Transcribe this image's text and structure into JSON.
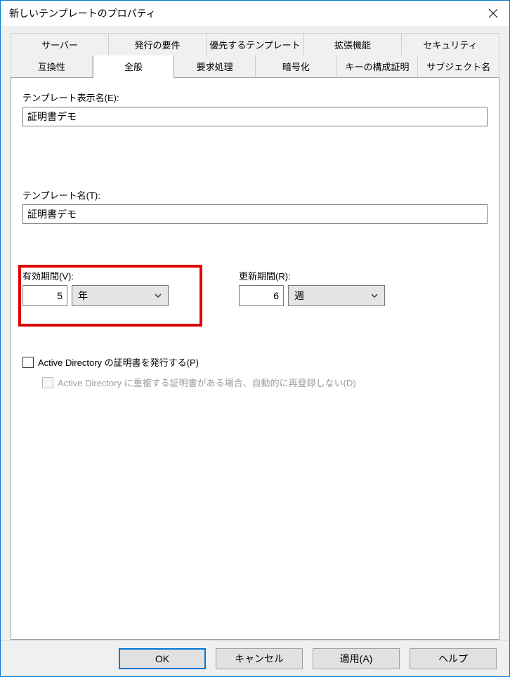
{
  "title": "新しいテンプレートのプロパティ",
  "tabs_row1": [
    "サーバー",
    "発行の要件",
    "優先するテンプレート",
    "拡張機能",
    "セキュリティ"
  ],
  "tabs_row2": [
    "互換性",
    "全般",
    "要求処理",
    "暗号化",
    "キーの構成証明",
    "サブジェクト名"
  ],
  "active_tab": "全般",
  "display_name_label": "テンプレート表示名(E):",
  "display_name_value": "証明書デモ",
  "template_name_label": "テンプレート名(T):",
  "template_name_value": "証明書デモ",
  "validity_label": "有効期間(V):",
  "validity_value": "5",
  "validity_unit": "年",
  "renewal_label": "更新期間(R):",
  "renewal_value": "6",
  "renewal_unit": "週",
  "ad_publish_label": "Active Directory の証明書を発行する(P)",
  "ad_dup_label": "Active Directory に重複する証明書がある場合、自動的に再登録しない(D)",
  "buttons": {
    "ok": "OK",
    "cancel": "キャンセル",
    "apply": "適用(A)",
    "help": "ヘルプ"
  }
}
